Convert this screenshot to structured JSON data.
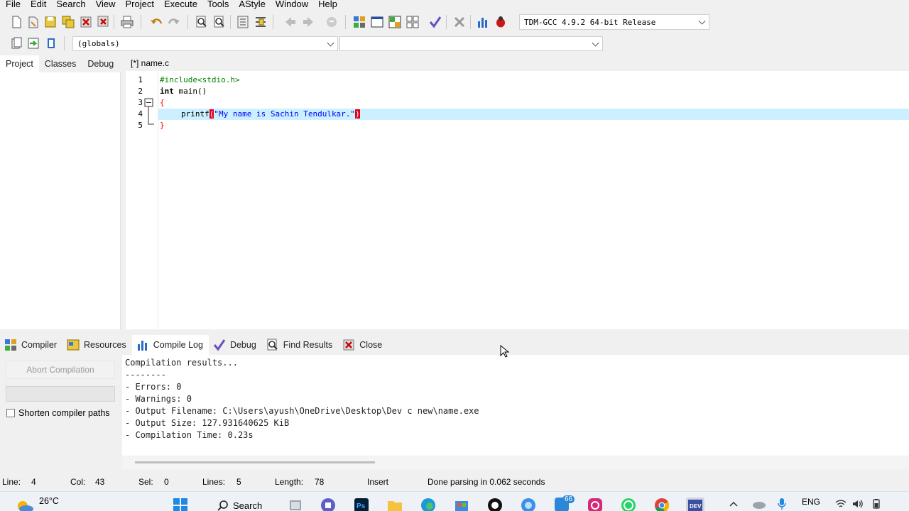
{
  "menu": [
    "File",
    "Edit",
    "Search",
    "View",
    "Project",
    "Execute",
    "Tools",
    "AStyle",
    "Window",
    "Help"
  ],
  "toolbar": {
    "compiler_select": "TDM-GCC 4.9.2 64-bit Release",
    "scope_select": "(globals)",
    "function_select": ""
  },
  "left_tabs": [
    "Project",
    "Classes",
    "Debug"
  ],
  "editor": {
    "tab_label": "[*] name.c",
    "line_numbers": [
      "1",
      "2",
      "3",
      "4",
      "5"
    ],
    "lines": {
      "l1": "#include<stdio.h>",
      "l2_kw": "int",
      "l2_rest": " main()",
      "l3": "{",
      "l4_fn": "printf",
      "l4_open": "(",
      "l4_str": "\"My name is Sachin Tendulkar.\"",
      "l4_close": ")",
      "l5": "}"
    }
  },
  "bottom_tabs": [
    "Compiler",
    "Resources",
    "Compile Log",
    "Debug",
    "Find Results",
    "Close"
  ],
  "bottom_left": {
    "abort": "Abort Compilation",
    "shorten": "Shorten compiler paths"
  },
  "log": [
    "Compilation results...",
    "--------",
    "- Errors: 0",
    "- Warnings: 0",
    "- Output Filename: C:\\Users\\ayush\\OneDrive\\Desktop\\Dev c new\\name.exe",
    "- Output Size: 127.931640625 KiB",
    "- Compilation Time: 0.23s"
  ],
  "status": {
    "line_label": "Line:",
    "line_val": "4",
    "col_label": "Col:",
    "col_val": "43",
    "sel_label": "Sel:",
    "sel_val": "0",
    "lines_label": "Lines:",
    "lines_val": "5",
    "length_label": "Length:",
    "length_val": "78",
    "mode": "Insert",
    "message": "Done parsing in 0.062 seconds"
  },
  "taskbar": {
    "temperature": "26°C",
    "search": "Search",
    "language": "ENG",
    "badge": "66"
  }
}
